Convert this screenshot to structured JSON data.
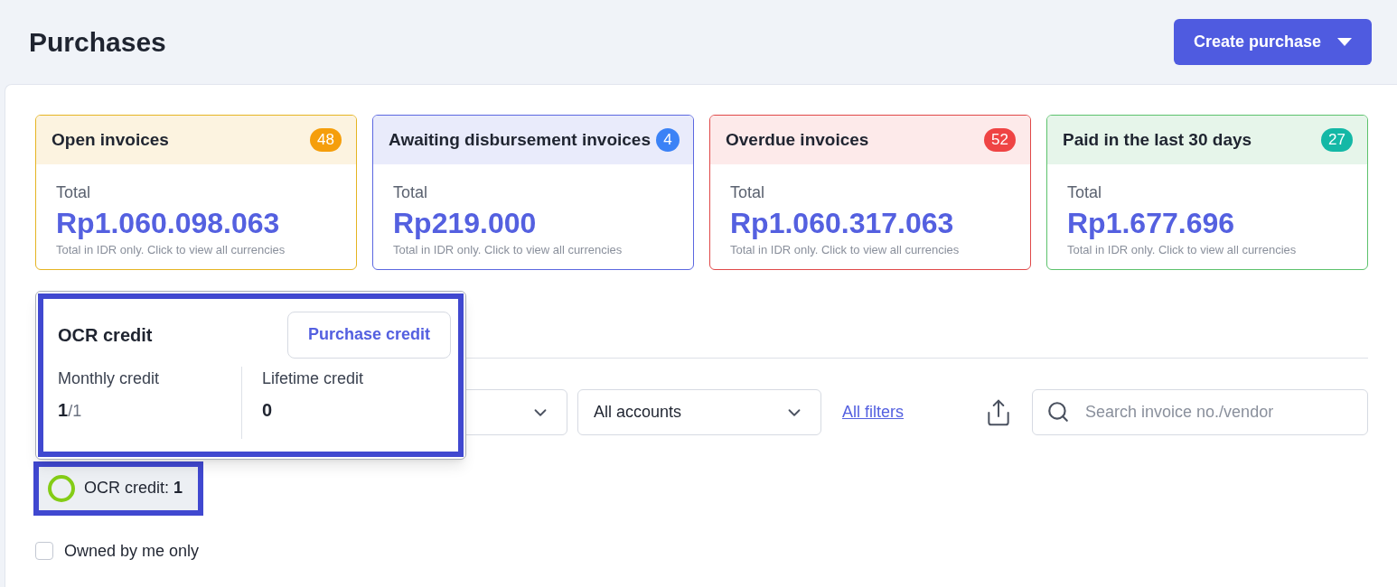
{
  "page": {
    "title": "Purchases",
    "create_button": "Create purchase"
  },
  "cards": [
    {
      "kind": "open",
      "title": "Open invoices",
      "count": "48",
      "color": "#f59e0b",
      "label": "Total",
      "amount": "Rp1.060.098.063",
      "note": "Total in IDR only. Click to view all currencies"
    },
    {
      "kind": "awaiting",
      "title": "Awaiting disbursement invoices",
      "count": "4",
      "color": "#3b82f6",
      "label": "Total",
      "amount": "Rp219.000",
      "note": "Total in IDR only. Click to view all currencies"
    },
    {
      "kind": "overdue",
      "title": "Overdue invoices",
      "count": "52",
      "color": "#ef4444",
      "label": "Total",
      "amount": "Rp1.060.317.063",
      "note": "Total in IDR only. Click to view all currencies"
    },
    {
      "kind": "paid",
      "title": "Paid in the last 30 days",
      "count": "27",
      "color": "#14b8a6",
      "label": "Total",
      "amount": "Rp1.677.696",
      "note": "Total in IDR only. Click to view all currencies"
    }
  ],
  "ocr_popover": {
    "title": "OCR credit",
    "button": "Purchase credit",
    "monthly_label": "Monthly credit",
    "monthly_value": "1",
    "monthly_suffix": "/1",
    "lifetime_label": "Lifetime credit",
    "lifetime_value": "0"
  },
  "filters": {
    "accounts": "All accounts",
    "all_filters": "All filters",
    "search_placeholder": "Search invoice no./vendor"
  },
  "ocr_chip": {
    "text": "OCR credit: **1**"
  },
  "owned_by_me": {
    "label": "Owned by me only",
    "checked": false
  }
}
